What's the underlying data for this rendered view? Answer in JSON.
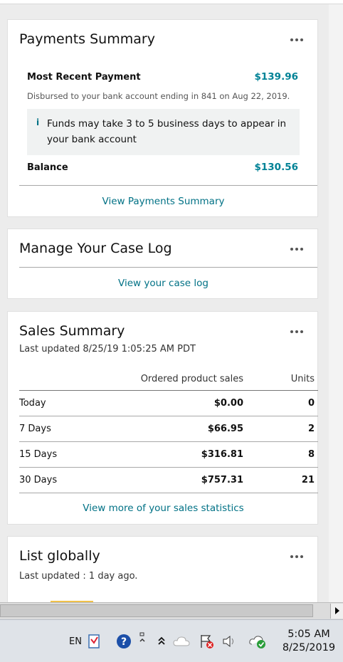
{
  "payments": {
    "title": "Payments Summary",
    "recent_label": "Most Recent Payment",
    "recent_amount": "$139.96",
    "disbursed_text": "Disbursed to your bank account ending in 841 on Aug 22, 2019.",
    "info_note": "Funds may take 3 to 5 business days to appear in your bank account",
    "balance_label": "Balance",
    "balance_amount": "$130.56",
    "link": "View Payments Summary"
  },
  "caselog": {
    "title": "Manage Your Case Log",
    "link": "View your case log"
  },
  "sales": {
    "title": "Sales Summary",
    "updated": "Last updated 8/25/19 1:05:25 AM PDT",
    "col_sales": "Ordered product sales",
    "col_units": "Units",
    "rows": [
      {
        "period": "Today",
        "sales": "$0.00",
        "units": "0"
      },
      {
        "period": "7 Days",
        "sales": "$66.95",
        "units": "2"
      },
      {
        "period": "15 Days",
        "sales": "$316.81",
        "units": "8"
      },
      {
        "period": "30 Days",
        "sales": "$757.31",
        "units": "21"
      }
    ],
    "link": "View more of your sales statistics"
  },
  "global": {
    "title": "List globally",
    "updated": "Last updated : 1 day ago."
  },
  "taskbar": {
    "lang": "EN",
    "time": "5:05 AM",
    "date": "8/25/2019",
    "icons": [
      "document-icon",
      "help-icon",
      "show-hidden-icon",
      "cloud-icon",
      "action-center-flag-icon",
      "volume-icon",
      "network-icon"
    ]
  },
  "colors": {
    "accent": "#007185",
    "amount": "#008296",
    "background": "#ececec"
  }
}
